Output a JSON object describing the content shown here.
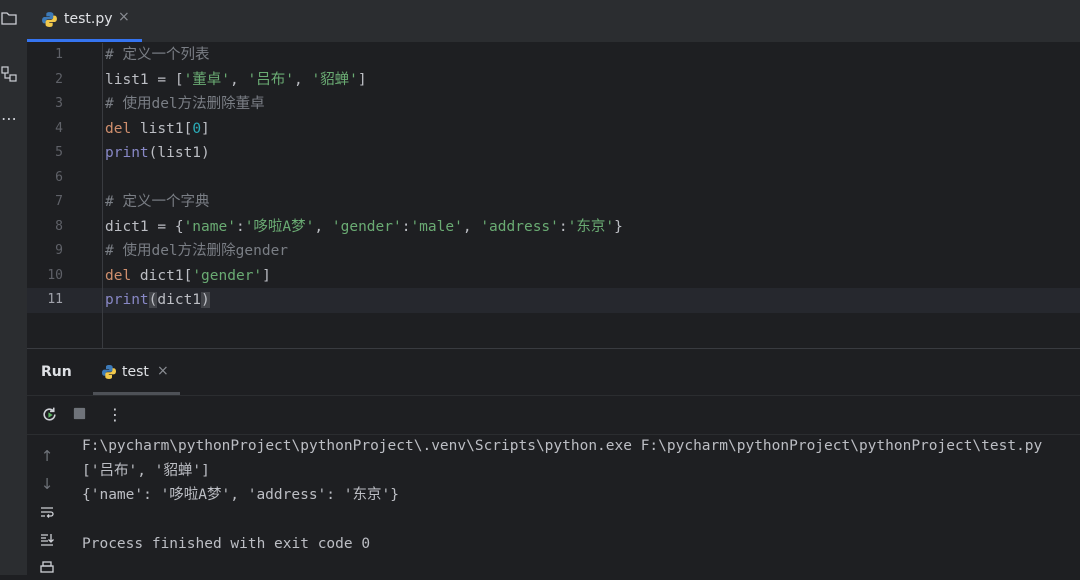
{
  "tool_strip": {
    "icons": [
      "folder-icon",
      "structure-icon",
      "more-icon"
    ]
  },
  "editor_tab": {
    "filename": "test.py",
    "close": "×"
  },
  "editor": {
    "line_numbers": [
      "1",
      "2",
      "3",
      "4",
      "5",
      "6",
      "7",
      "8",
      "9",
      "10",
      "11"
    ],
    "current_line": "11",
    "lines": [
      [
        {
          "t": "# 定义一个列表",
          "c": "comment"
        }
      ],
      [
        {
          "t": "list1 = [",
          "c": "txt"
        },
        {
          "t": "'董卓'",
          "c": "str"
        },
        {
          "t": ", ",
          "c": "txt"
        },
        {
          "t": "'吕布'",
          "c": "str"
        },
        {
          "t": ", ",
          "c": "txt"
        },
        {
          "t": "'貂蝉'",
          "c": "str"
        },
        {
          "t": "]",
          "c": "txt"
        }
      ],
      [
        {
          "t": "# 使用del方法删除董卓",
          "c": "comment"
        }
      ],
      [
        {
          "t": "del",
          "c": "kw"
        },
        {
          "t": " list1[",
          "c": "txt"
        },
        {
          "t": "0",
          "c": "num"
        },
        {
          "t": "]",
          "c": "txt"
        }
      ],
      [
        {
          "t": "print",
          "c": "fn"
        },
        {
          "t": "(list1)",
          "c": "txt"
        }
      ],
      [],
      [
        {
          "t": "# 定义一个字典",
          "c": "comment"
        }
      ],
      [
        {
          "t": "dict1 = {",
          "c": "txt"
        },
        {
          "t": "'name'",
          "c": "str"
        },
        {
          "t": ":",
          "c": "txt"
        },
        {
          "t": "'哆啦A梦'",
          "c": "str"
        },
        {
          "t": ", ",
          "c": "txt"
        },
        {
          "t": "'gender'",
          "c": "str"
        },
        {
          "t": ":",
          "c": "txt"
        },
        {
          "t": "'male'",
          "c": "str"
        },
        {
          "t": ", ",
          "c": "txt"
        },
        {
          "t": "'address'",
          "c": "str"
        },
        {
          "t": ":",
          "c": "txt"
        },
        {
          "t": "'东京'",
          "c": "str"
        },
        {
          "t": "}",
          "c": "txt"
        }
      ],
      [
        {
          "t": "# 使用del方法删除gender",
          "c": "comment"
        }
      ],
      [
        {
          "t": "del",
          "c": "kw"
        },
        {
          "t": " dict1[",
          "c": "txt"
        },
        {
          "t": "'gender'",
          "c": "str"
        },
        {
          "t": "]",
          "c": "txt"
        }
      ],
      [
        {
          "t": "print",
          "c": "fn"
        },
        {
          "t": "(",
          "c": "br"
        },
        {
          "t": "dict1",
          "c": "txt"
        },
        {
          "t": ")",
          "c": "br"
        }
      ]
    ]
  },
  "run_panel": {
    "label": "Run",
    "tab_name": "test",
    "tab_close": "×",
    "toolbar": {
      "rerun": "rerun-icon",
      "stop": "stop-icon",
      "more": "⋮"
    },
    "side_tools": [
      "arrow-up-icon",
      "arrow-down-icon",
      "soft-wrap-icon",
      "scroll-to-end-icon",
      "print-icon"
    ],
    "output": [
      "F:\\pycharm\\pythonProject\\pythonProject\\.venv\\Scripts\\python.exe F:\\pycharm\\pythonProject\\pythonProject\\test.py",
      "['吕布', '貂蝉']",
      "{'name': '哆啦A梦', 'address': '东京'}",
      "",
      "Process finished with exit code 0"
    ]
  },
  "colors": {
    "accent": "#3574f0",
    "comment": "#7a7e85",
    "keyword": "#cf8e6d",
    "string": "#6aab73",
    "number": "#2aacb8",
    "builtin": "#8888c6"
  }
}
